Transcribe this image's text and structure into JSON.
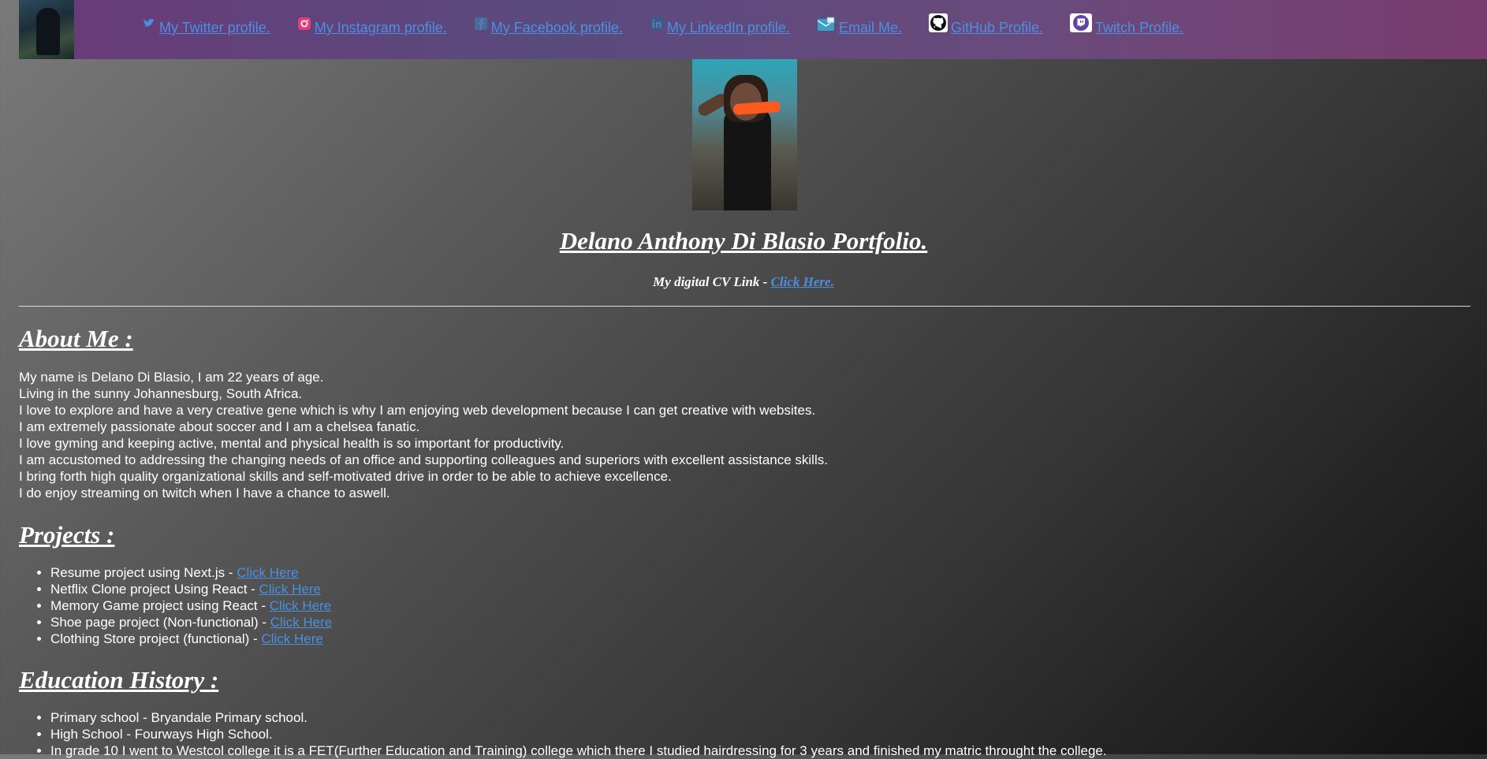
{
  "nav": {
    "links": [
      {
        "icon": "twitter-icon",
        "label": "My Twitter profile."
      },
      {
        "icon": "instagram-icon",
        "label": "My Instagram profile."
      },
      {
        "icon": "facebook-icon",
        "label": "My Facebook profile."
      },
      {
        "icon": "linkedin-icon",
        "label": "My LinkedIn profile."
      },
      {
        "icon": "email-icon",
        "label": "Email Me."
      },
      {
        "icon": "github-icon",
        "label": "GitHub Profile."
      },
      {
        "icon": "twitch-icon",
        "label": "Twitch Profile."
      }
    ]
  },
  "header": {
    "title": "Delano Anthony Di Blasio Portfolio.",
    "cv_prefix": "My digital CV Link - ",
    "cv_link": "Click Here."
  },
  "about": {
    "heading": "About Me :",
    "lines": [
      "My name is Delano Di Blasio, I am 22 years of age.",
      "Living in the sunny Johannesburg, South Africa.",
      "I love to explore and have a very creative gene which is why I am enjoying web development because I can get creative with websites.",
      "I am extremely passionate about soccer and I am a chelsea fanatic.",
      "I love gyming and keeping active, mental and physical health is so important for productivity.",
      "I am accustomed to addressing the changing needs of an office and supporting colleagues and superiors with excellent assistance skills.",
      "I bring forth high quality organizational skills and self-motivated drive in order to be able to achieve excellence.",
      "I do enjoy streaming on twitch when I have a chance to aswell."
    ]
  },
  "projects": {
    "heading": "Projects :",
    "items": [
      {
        "text": "Resume project using Next.js - ",
        "link": "Click Here"
      },
      {
        "text": "Netflix Clone project Using React - ",
        "link": "Click Here"
      },
      {
        "text": "Memory Game project using React - ",
        "link": "Click Here"
      },
      {
        "text": "Shoe page project (Non-functional) - ",
        "link": "Click Here"
      },
      {
        "text": "Clothing Store project (functional) - ",
        "link": "Click Here"
      }
    ]
  },
  "education": {
    "heading": "Education History :",
    "items": [
      "Primary school - Bryandale Primary school.",
      "High School - Fourways High School.",
      "In grade 10 I went to Westcol college it is a FET(Further Education and Training) college which there I studied hairdressing for 3 years and finished my matric throught the college."
    ]
  },
  "colors": {
    "link": "#4a90e2",
    "nav_bg": "#6a3a78",
    "text": "#ffffff"
  }
}
